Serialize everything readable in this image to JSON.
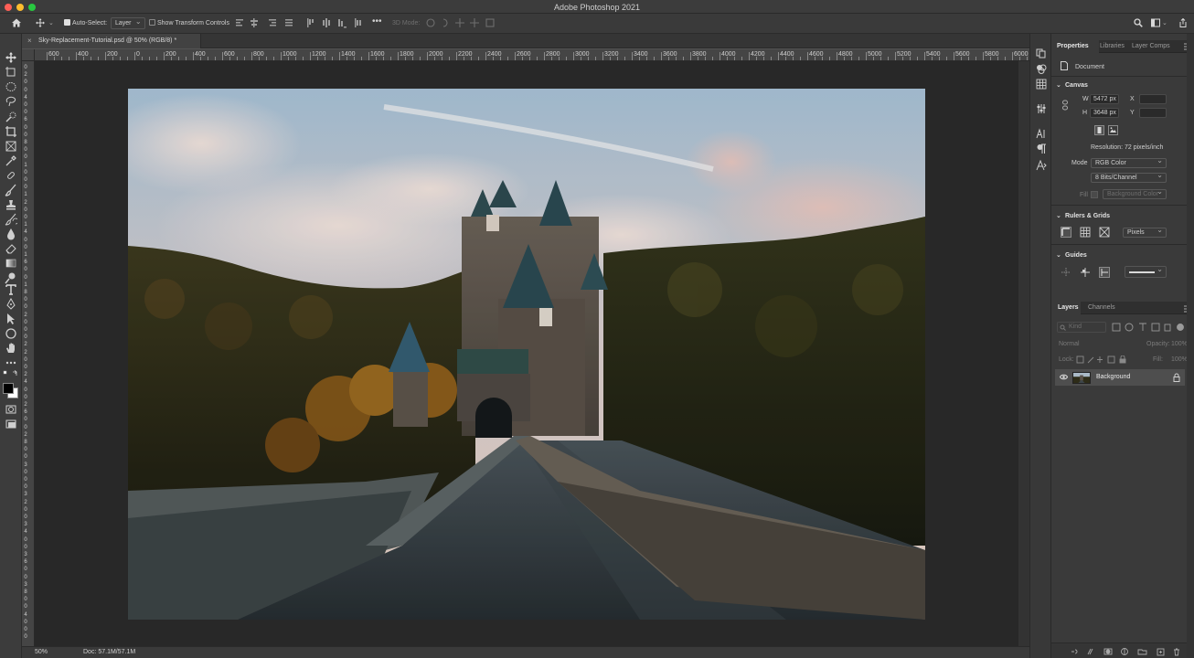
{
  "window": {
    "title": "Adobe Photoshop 2021"
  },
  "options_bar": {
    "auto_select_label": "Auto-Select:",
    "auto_select_checked": true,
    "auto_select_target": "Layer",
    "transform_controls_label": "Show Transform Controls",
    "mode_3d_label": "3D Mode:"
  },
  "document": {
    "tab_label": "Sky-Replacement-Tutorial.psd @ 50% (RGB/8) *",
    "close_glyph": "×",
    "ruler_h": [
      "600",
      "400",
      "200",
      "0",
      "200",
      "400",
      "600",
      "800",
      "1000",
      "1200",
      "1400",
      "1600",
      "1800",
      "2000",
      "2200",
      "2400",
      "2600",
      "2800",
      "3000",
      "3200",
      "3400",
      "3600",
      "3800",
      "4000",
      "4200",
      "4400",
      "4600",
      "4800",
      "5000",
      "5200",
      "5400",
      "5600",
      "5800",
      "6000"
    ],
    "ruler_v": [
      "0",
      "2",
      "0",
      "0",
      "4",
      "0",
      "0",
      "6",
      "0",
      "0",
      "8",
      "0",
      "0",
      "1",
      "0",
      "0",
      "0",
      "1",
      "2",
      "0",
      "0",
      "1",
      "4",
      "0",
      "0",
      "1",
      "6",
      "0",
      "0",
      "1",
      "8",
      "0",
      "0",
      "2",
      "0",
      "0",
      "0",
      "2",
      "2",
      "0",
      "0",
      "2",
      "4",
      "0",
      "0",
      "2",
      "6",
      "0",
      "0",
      "2",
      "8",
      "0",
      "0",
      "3",
      "0",
      "0",
      "0",
      "3",
      "2",
      "0",
      "0",
      "3",
      "4",
      "0",
      "0",
      "3",
      "6",
      "0",
      "0",
      "3",
      "8",
      "0",
      "0",
      "4",
      "0",
      "0",
      "0"
    ]
  },
  "status_bar": {
    "zoom": "50%",
    "doc_size": "Doc: 57.1M/57.1M"
  },
  "properties_panel": {
    "tabs": [
      {
        "label": "Properties",
        "active": true
      },
      {
        "label": "Libraries",
        "active": false
      },
      {
        "label": "Layer Comps",
        "active": false
      }
    ],
    "document_label": "Document",
    "canvas": {
      "heading": "Canvas",
      "w_label": "W",
      "w_value": "5472 px",
      "h_label": "H",
      "h_value": "3648 px",
      "x_label": "X",
      "y_label": "Y",
      "resolution": "Resolution: 72 pixels/inch",
      "mode_label": "Mode",
      "mode_value": "RGB Color",
      "bits_value": "8 Bits/Channel",
      "fill_label": "Fill",
      "fill_value": "Background Color"
    },
    "rulers_grids": {
      "heading": "Rulers & Grids",
      "units": "Pixels"
    },
    "guides": {
      "heading": "Guides"
    }
  },
  "layers_panel": {
    "tabs": [
      {
        "label": "Layers",
        "active": true
      },
      {
        "label": "Channels",
        "active": false
      }
    ],
    "filter_kind": "Kind",
    "blend_mode": "Normal",
    "opacity_label": "Opacity:",
    "opacity_value": "100%",
    "lock_label": "Lock:",
    "fill_label": "Fill:",
    "fill_value": "100%",
    "layers": [
      {
        "name": "Background",
        "visible": true,
        "locked": true
      }
    ]
  },
  "colors": {
    "app_bg": "#535353",
    "panel_bg": "#3a3a3a",
    "canvas_bg": "#282828",
    "accent": "#e8e8e8"
  }
}
